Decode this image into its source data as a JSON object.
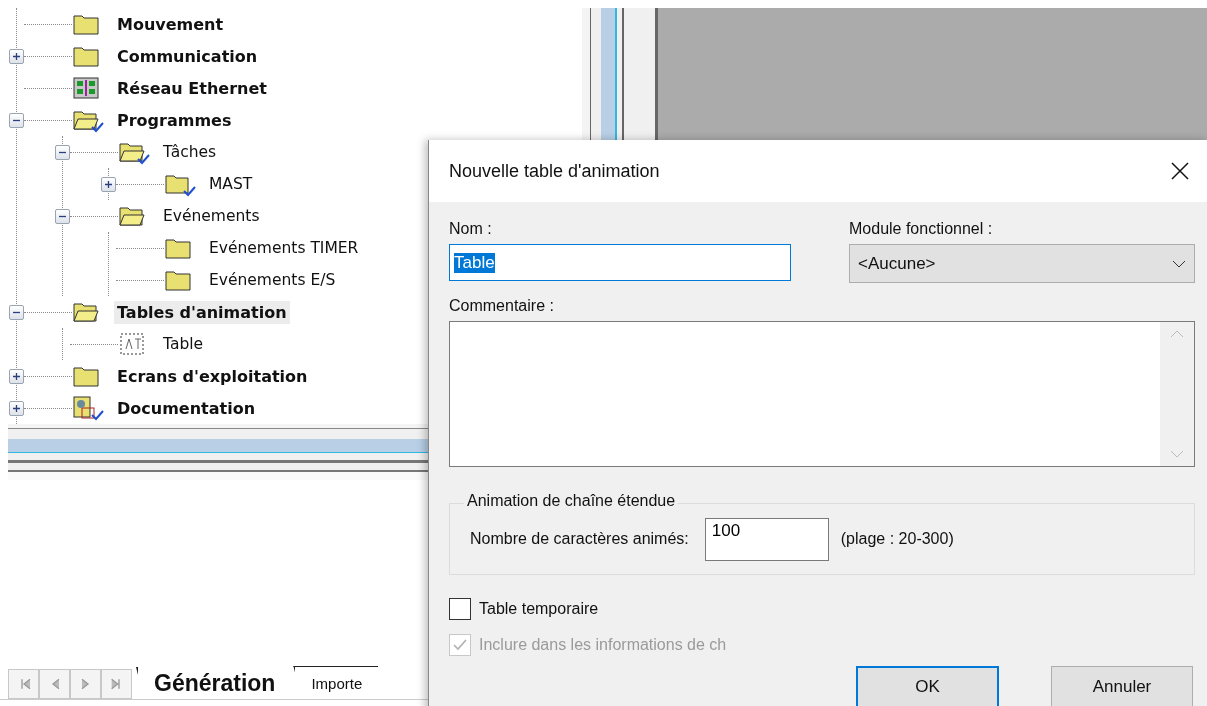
{
  "tree": [
    {
      "label": "Mouvement",
      "bold": true,
      "kind": "folder",
      "selected": false
    },
    {
      "label": "Communication",
      "bold": true,
      "kind": "folder",
      "selected": false,
      "expanded": false
    },
    {
      "label": "Réseau Ethernet",
      "bold": true,
      "kind": "network",
      "selected": false
    },
    {
      "label": "Programmes",
      "bold": true,
      "kind": "program",
      "selected": false,
      "expanded": true,
      "children": [
        {
          "label": "Tâches",
          "bold": false,
          "kind": "program",
          "selected": false,
          "expanded": true,
          "children": [
            {
              "label": "MAST",
              "bold": false,
              "kind": "task",
              "selected": false,
              "expanded": false
            }
          ]
        },
        {
          "label": "Evénements",
          "bold": false,
          "kind": "group",
          "selected": false,
          "expanded": true,
          "children": [
            {
              "label": "Evénements TIMER",
              "bold": false,
              "kind": "folder",
              "selected": false
            },
            {
              "label": "Evénements E/S",
              "bold": false,
              "kind": "folder",
              "selected": false
            }
          ]
        }
      ]
    },
    {
      "label": "Tables d'animation",
      "bold": true,
      "kind": "group",
      "selected": true,
      "expanded": true,
      "children": [
        {
          "label": "Table",
          "bold": false,
          "kind": "table",
          "selected": false
        }
      ]
    },
    {
      "label": "Ecrans d'exploitation",
      "bold": true,
      "kind": "folder",
      "selected": false,
      "expanded": false
    },
    {
      "label": "Documentation",
      "bold": true,
      "kind": "documentation",
      "selected": false,
      "expanded": false
    }
  ],
  "tabs": [
    {
      "label": "Génération",
      "selected": true
    },
    {
      "label": "Importe",
      "selected": false
    }
  ],
  "dialog": {
    "title": "Nouvelle table d'animation",
    "name": {
      "label": "Nom :",
      "value": "Table",
      "text_selected": true
    },
    "module": {
      "label": "Module fonctionnel :",
      "value": "<Aucune>"
    },
    "comment": {
      "label": "Commentaire :"
    },
    "group": {
      "title": "Animation de chaîne étendue",
      "label": "Nombre de caractères animés:",
      "value": "100",
      "hint": "(plage : 20-300)"
    },
    "checkboxes": [
      {
        "label": "Table temporaire",
        "checked": false,
        "disabled": false
      },
      {
        "label": "Inclure dans les informations de ch",
        "checked": true,
        "disabled": true
      }
    ],
    "buttons": [
      {
        "label": "OK",
        "default": true
      },
      {
        "label": "Annuler",
        "default": false
      }
    ]
  }
}
